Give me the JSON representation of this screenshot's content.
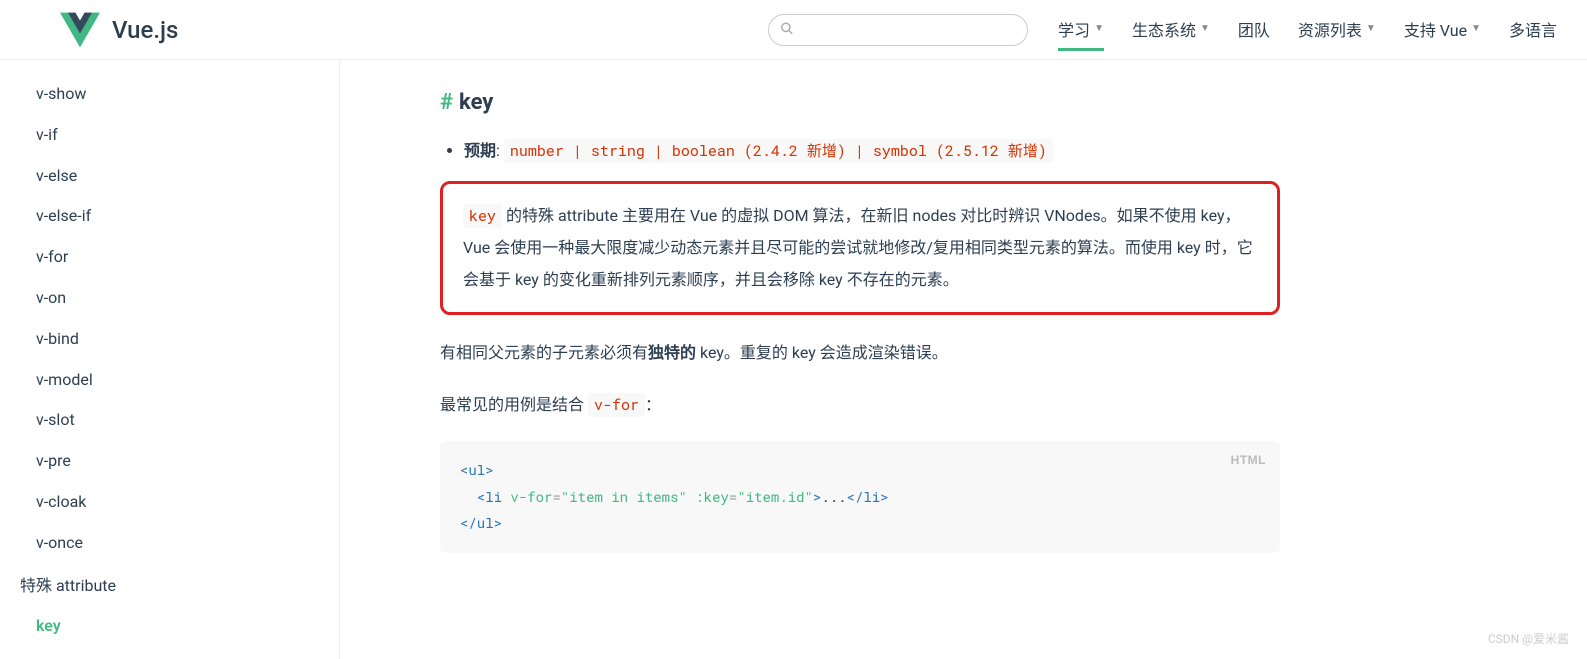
{
  "header": {
    "logo_text": "Vue.js",
    "nav": [
      {
        "label": "学习",
        "caret": true,
        "active": true
      },
      {
        "label": "生态系统",
        "caret": true,
        "active": false
      },
      {
        "label": "团队",
        "caret": false,
        "active": false
      },
      {
        "label": "资源列表",
        "caret": true,
        "active": false
      },
      {
        "label": "支持 Vue",
        "caret": true,
        "active": false
      },
      {
        "label": "多语言",
        "caret": false,
        "active": false
      }
    ]
  },
  "sidebar": {
    "items": [
      {
        "label": "v-show",
        "type": "item",
        "active": false
      },
      {
        "label": "v-if",
        "type": "item",
        "active": false
      },
      {
        "label": "v-else",
        "type": "item",
        "active": false
      },
      {
        "label": "v-else-if",
        "type": "item",
        "active": false
      },
      {
        "label": "v-for",
        "type": "item",
        "active": false
      },
      {
        "label": "v-on",
        "type": "item",
        "active": false
      },
      {
        "label": "v-bind",
        "type": "item",
        "active": false
      },
      {
        "label": "v-model",
        "type": "item",
        "active": false
      },
      {
        "label": "v-slot",
        "type": "item",
        "active": false
      },
      {
        "label": "v-pre",
        "type": "item",
        "active": false
      },
      {
        "label": "v-cloak",
        "type": "item",
        "active": false
      },
      {
        "label": "v-once",
        "type": "item",
        "active": false
      },
      {
        "label": "特殊 attribute",
        "type": "heading",
        "active": false
      },
      {
        "label": "key",
        "type": "item",
        "active": true
      }
    ]
  },
  "content": {
    "heading": "key",
    "hash": "#",
    "expected": {
      "label": "预期",
      "colon": ": ",
      "types": "number | string | boolean (2.4.2 新增) | symbol (2.5.12 新增)"
    },
    "highlight": {
      "code": "key",
      "text1": " 的特殊 attribute 主要用在 Vue 的虚拟 DOM 算法，在新旧 nodes 对比时辨识 VNodes。如果不使用 key，Vue 会使用一种最大限度减少动态元素并且尽可能的尝试就地修改/复用相同类型元素的算法。而使用 key 时，它会基于 key 的变化重新排列元素顺序，并且会移除 key 不存在的元素。"
    },
    "para2": {
      "p1": "有相同父元素的子元素必须有",
      "bold": "独特的",
      "p2": " key。重复的 key 会造成渲染错误。"
    },
    "para3": {
      "p1": "最常见的用例是结合 ",
      "code": "v-for",
      "p2": "："
    },
    "code_block": {
      "lang": "HTML",
      "line1": {
        "open_tag": "<ul",
        "close": ">"
      },
      "line2": {
        "indent": "  ",
        "open_tag": "<li",
        "attr1": " v-for",
        "eq1": "=",
        "val1": "\"item in items\"",
        "attr2": " :key",
        "eq2": "=",
        "val2": "\"item.id\"",
        "close": ">",
        "content": "...",
        "end_tag": "</li>"
      },
      "line3": {
        "end_tag": "</ul>"
      }
    }
  },
  "watermark": "CSDN @爱米酱"
}
